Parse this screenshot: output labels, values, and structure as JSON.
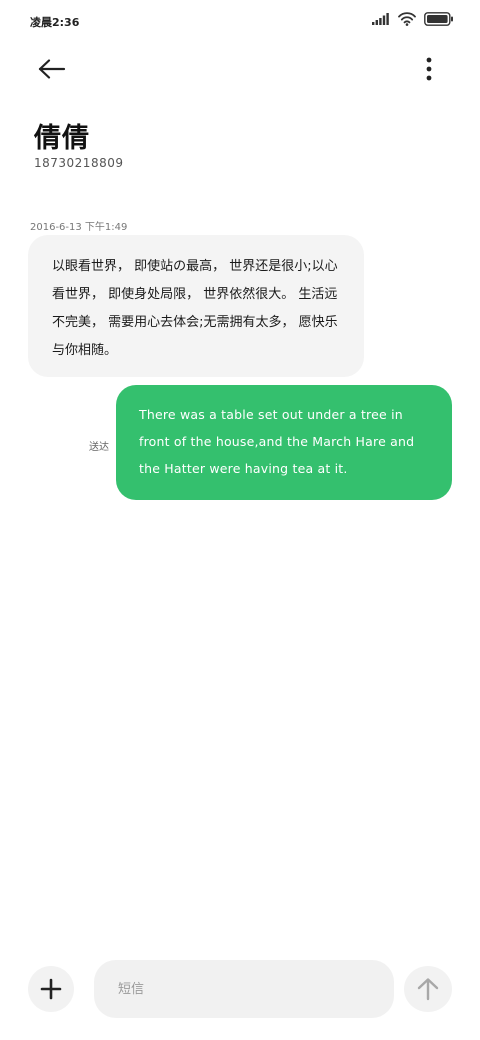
{
  "status_bar": {
    "time": "凌晨2:36",
    "icons": [
      "signal-icon",
      "wifi-icon",
      "battery-icon"
    ]
  },
  "header": {
    "back_icon": "arrow-left-icon",
    "more_icon": "more-vertical-icon"
  },
  "contact": {
    "name": "倩倩",
    "number": "18730218809"
  },
  "conversation": {
    "timestamp": "2016-6-13  下午1:49",
    "messages": [
      {
        "direction": "incoming",
        "text": "以眼看世界， 即使站の最高， 世界还是很小;以心看世界， 即使身处局限， 世界依然很大。 生活远不完美， 需要用心去体会;无需拥有太多， 愿快乐与你相随。"
      },
      {
        "direction": "outgoing",
        "status": "送达",
        "text": "There was a table set out under a tree in front of the house,and the March Hare and the Hatter were having tea at it."
      }
    ]
  },
  "composer": {
    "placeholder": "短信",
    "add_icon": "plus-icon",
    "send_icon": "arrow-up-icon"
  },
  "colors": {
    "outgoing_bubble": "#34c06e",
    "incoming_bubble": "#f4f4f4",
    "background": "#ffffff"
  }
}
